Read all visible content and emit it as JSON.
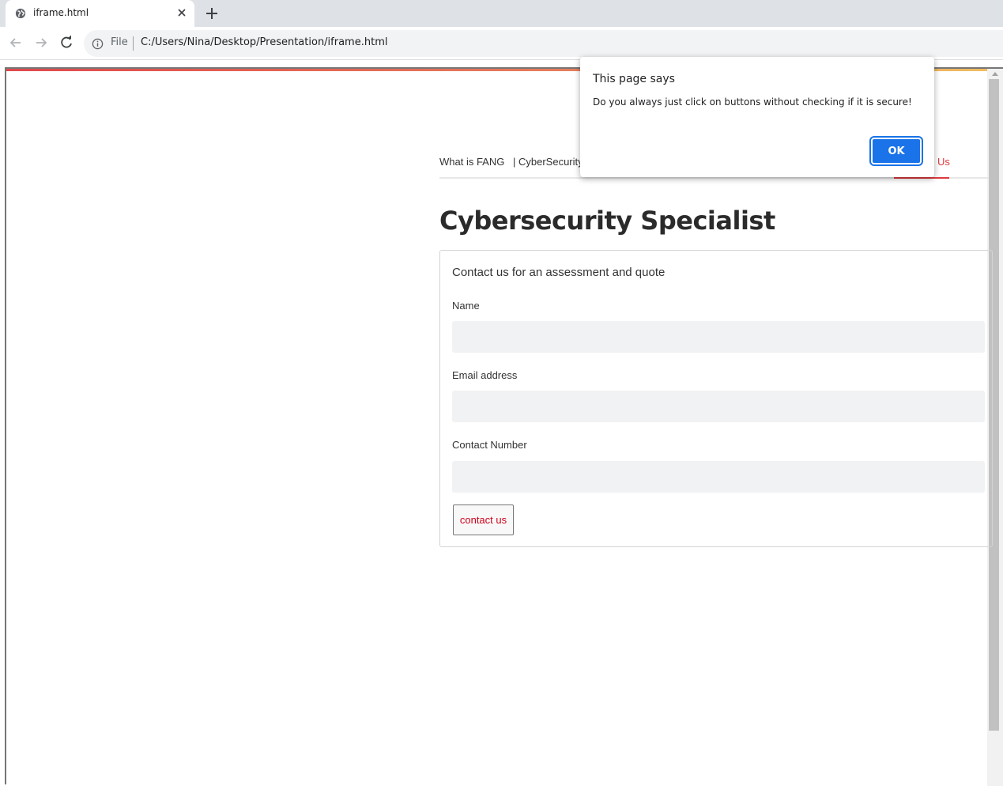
{
  "browser": {
    "tab_title": "iframe.html",
    "scheme_label": "File",
    "url": "C:/Users/Nina/Desktop/Presentation/iframe.html"
  },
  "site": {
    "nav": [
      {
        "label": "What is FANG",
        "active": false
      },
      {
        "label": "| CyberSecurity",
        "active": false
      },
      {
        "label": "Us",
        "active": true
      }
    ],
    "heading": "Cybersecurity Specialist",
    "form": {
      "title": "Contact us for an assessment and quote",
      "fields": [
        {
          "label": "Name",
          "value": ""
        },
        {
          "label": "Email address",
          "value": ""
        },
        {
          "label": "Contact Number",
          "value": ""
        }
      ],
      "submit_label": "contact us"
    }
  },
  "dialog": {
    "title": "This page says",
    "message": "Do you always just click on buttons without checking if it is secure!",
    "ok_label": "OK"
  },
  "colors": {
    "accent": "#e03a3e",
    "dialog_button": "#1a73e8"
  },
  "icons": [
    "globe-icon",
    "close-icon",
    "plus-icon",
    "back-arrow-icon",
    "forward-arrow-icon",
    "reload-icon",
    "info-icon"
  ]
}
